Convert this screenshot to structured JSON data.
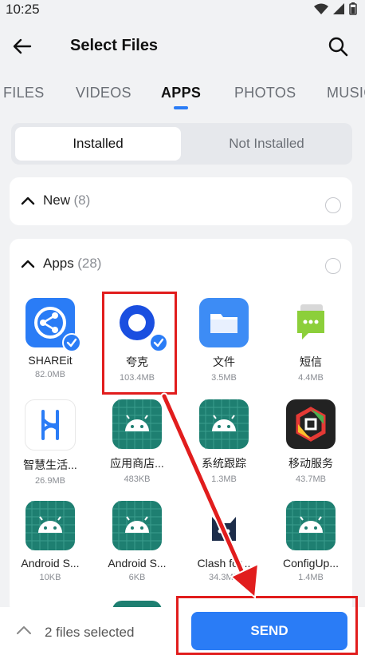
{
  "status": {
    "time": "10:25"
  },
  "appbar": {
    "title": "Select Files",
    "back_icon": "arrow-left-icon",
    "search_icon": "search-icon"
  },
  "tabs": [
    {
      "label": "FILES"
    },
    {
      "label": "VIDEOS"
    },
    {
      "label": "APPS",
      "active": true
    },
    {
      "label": "PHOTOS"
    },
    {
      "label": "MUSIC"
    }
  ],
  "segment": {
    "installed": "Installed",
    "not_installed": "Not Installed"
  },
  "sections": {
    "new": {
      "label": "New",
      "count": "(8)"
    },
    "apps": {
      "label": "Apps",
      "count": "(28)"
    }
  },
  "apps": [
    {
      "name": "SHAREit",
      "size": "82.0MB",
      "checked": true
    },
    {
      "name": "夸克",
      "size": "103.4MB",
      "checked": true
    },
    {
      "name": "文件",
      "size": "3.5MB",
      "checked": false
    },
    {
      "name": "短信",
      "size": "4.4MB",
      "checked": false
    },
    {
      "name": "智慧生活...",
      "size": "26.9MB",
      "checked": false
    },
    {
      "name": "应用商店...",
      "size": "483KB",
      "checked": false
    },
    {
      "name": "系统跟踪",
      "size": "1.3MB",
      "checked": false
    },
    {
      "name": "移动服务",
      "size": "43.7MB",
      "checked": false
    },
    {
      "name": "Android S...",
      "size": "10KB",
      "checked": false
    },
    {
      "name": "Android S...",
      "size": "6KB",
      "checked": false
    },
    {
      "name": "Clash for...",
      "size": "34.3MB",
      "checked": false
    },
    {
      "name": "ConfigUp...",
      "size": "1.4MB",
      "checked": false
    }
  ],
  "bottom": {
    "selected_text": "2 files selected",
    "send_label": "SEND"
  },
  "colors": {
    "accent": "#2a7cf6",
    "highlight": "#e11d1d",
    "android_bg": "#1e7f71"
  }
}
